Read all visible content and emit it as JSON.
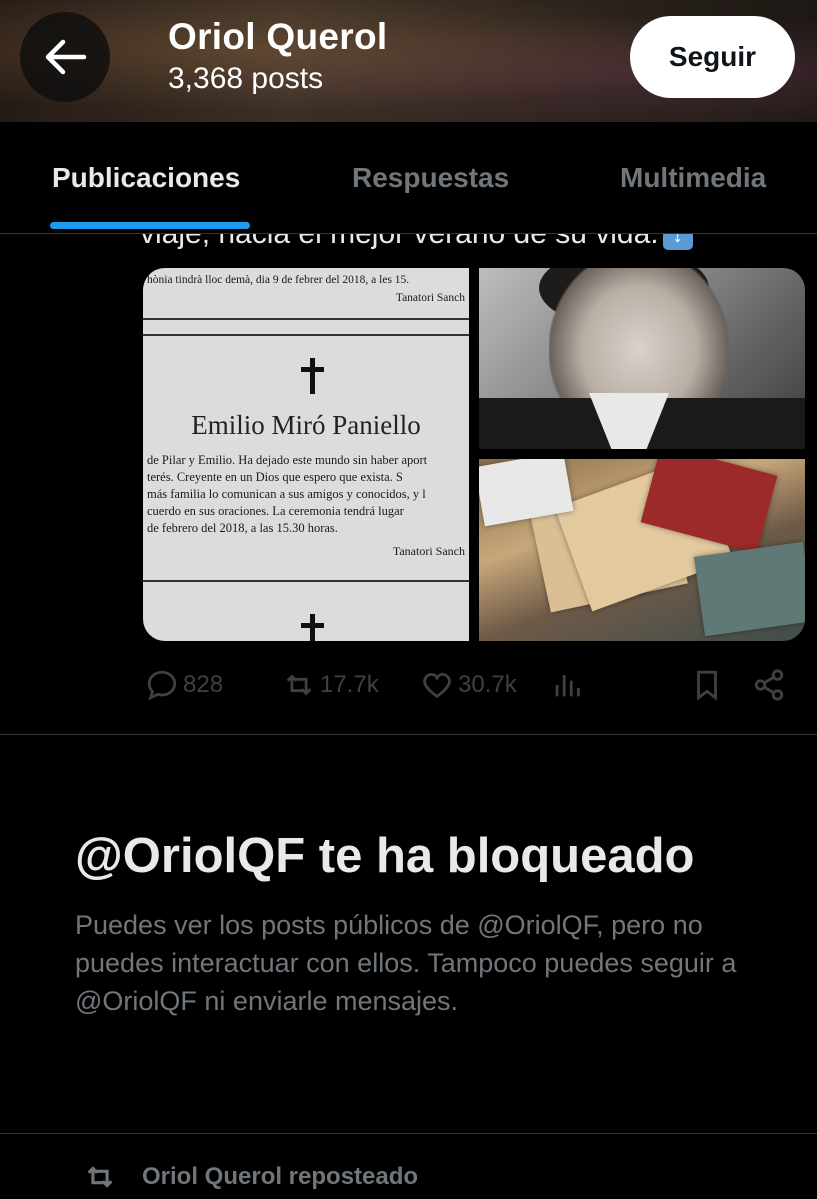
{
  "header": {
    "back_icon": "arrow-left-icon",
    "profile_name": "Oriol Querol",
    "post_count": "3,368 posts",
    "follow_label": "Seguir"
  },
  "tabs": [
    {
      "label": "Publicaciones",
      "active": true
    },
    {
      "label": "Respuestas",
      "active": false
    },
    {
      "label": "Multimedia",
      "active": false
    }
  ],
  "post": {
    "text_fragment": "viaje, hacia el mejor verano de su vida.",
    "emoji": "⬇️",
    "obituary": {
      "top_line": "hònia tindrà lloc demà, dia 9 de febrer del 2018, a les 15.",
      "top_sign": "Tanatori Sanch",
      "name": "Emilio Miró Paniello",
      "body": [
        "de Pilar y Emilio. Ha dejado este mundo sin haber aport",
        "terés. Creyente en un Dios que espero que exista. S",
        "más familia lo comunican a sus amigos y conocidos, y l",
        "cuerdo en sus oraciones. La ceremonia tendrá lugar",
        "de febrero del 2018, a las 15.30 horas."
      ],
      "bottom_sign": "Tanatori Sanch"
    },
    "actions": {
      "replies": "828",
      "reposts": "17.7k",
      "likes": "30.7k"
    }
  },
  "blocked": {
    "title": "@OriolQF te ha bloqueado",
    "description": "Puedes ver los posts públicos de @OriolQF, pero no puedes interactuar con ellos. Tampoco puedes seguir a @OriolQF ni enviarle mensajes."
  },
  "repost": {
    "label": "Oriol Querol reposteado"
  },
  "colors": {
    "background": "#000000",
    "text_primary": "#e7e9ea",
    "text_secondary": "#71767b",
    "accent": "#1d9bf0",
    "divider": "#2f3336"
  }
}
